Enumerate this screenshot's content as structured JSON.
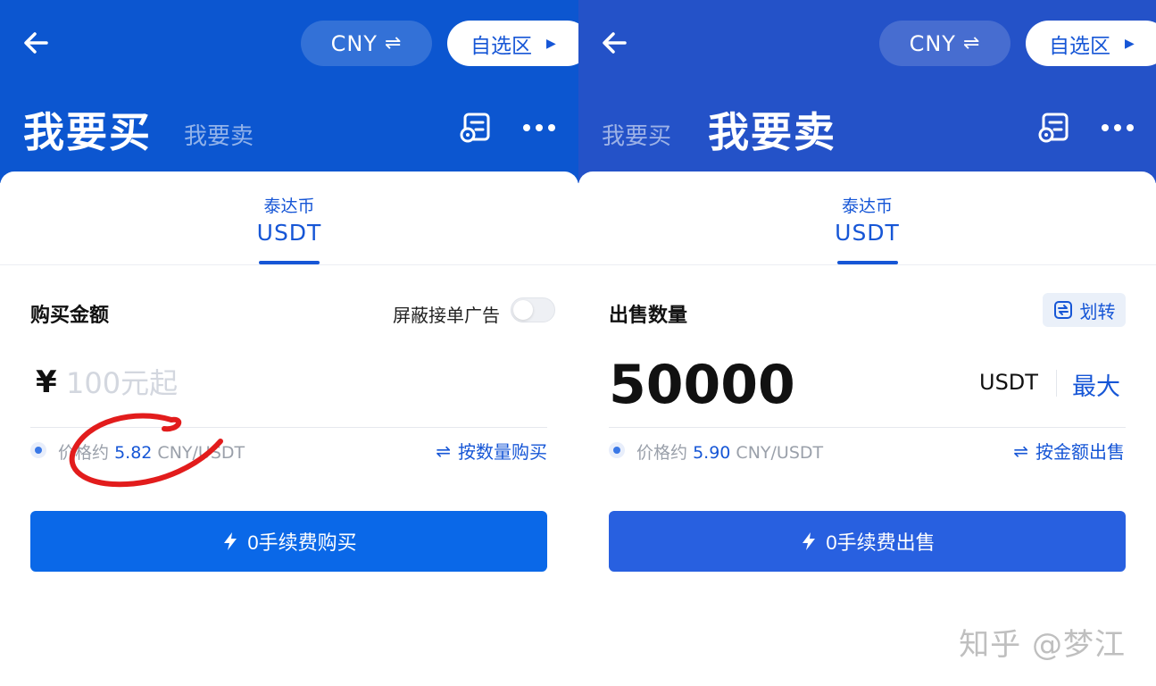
{
  "buy": {
    "currency": "CNY",
    "currency_swap_glyph": "⇌",
    "watchlist_label": "自选区",
    "watchlist_arrow": "▶",
    "tab_active": "我要买",
    "tab_inactive": "我要卖",
    "coin_cn": "泰达币",
    "coin_code": "USDT",
    "amount_label": "购买金额",
    "hide_ads_label": "屏蔽接单广告",
    "currency_symbol": "¥",
    "amount_placeholder": "100元起",
    "price_prefix": "价格约",
    "price_value": "5.82",
    "price_unit": "CNY/USDT",
    "switch_glyph": "⇌",
    "switch_label": "按数量购买",
    "cta_label": "0手续费购买"
  },
  "sell": {
    "currency": "CNY",
    "currency_swap_glyph": "⇌",
    "watchlist_label": "自选区",
    "watchlist_arrow": "▶",
    "tab_active": "我要卖",
    "tab_inactive": "我要买",
    "coin_cn": "泰达币",
    "coin_code": "USDT",
    "quantity_label": "出售数量",
    "transfer_label": "划转",
    "amount_value": "50000",
    "amount_unit": "USDT",
    "max_label": "最大",
    "price_prefix": "价格约",
    "price_value": "5.90",
    "price_unit": "CNY/USDT",
    "switch_glyph": "⇌",
    "switch_label": "按金额出售",
    "cta_label": "0手续费出售"
  },
  "watermark": "知乎 @梦江",
  "colors": {
    "header_blue": "#0c56d0",
    "header_blue_right": "#2452c8",
    "accent": "#1656d6",
    "cta": "#0a68e8",
    "annotation_red": "#e21c1c"
  },
  "icons": [
    "back-arrow-icon",
    "swap-icon",
    "play-triangle-icon",
    "order-record-icon",
    "more-dots-icon",
    "transfer-icon",
    "lightning-icon"
  ]
}
